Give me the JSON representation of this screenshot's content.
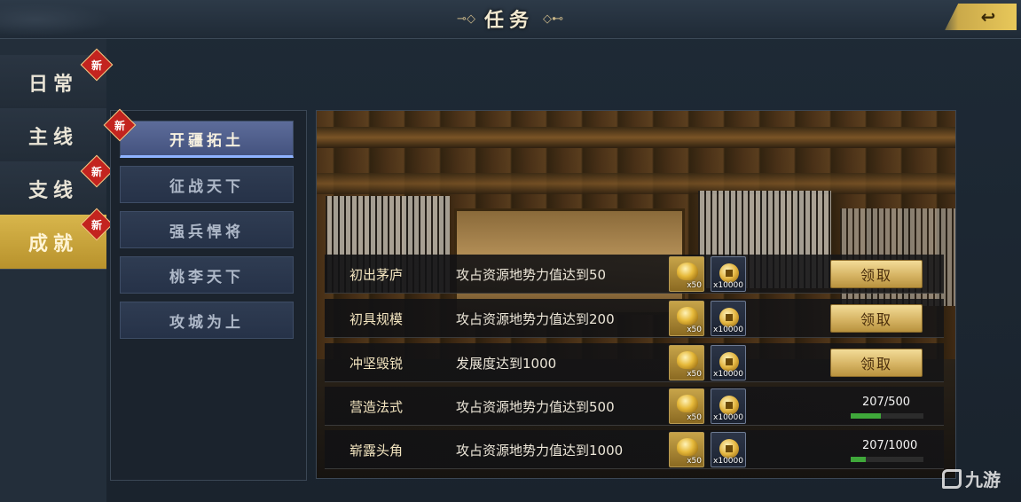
{
  "header": {
    "title": "任务",
    "ornament_left": "⊸◇",
    "ornament_right": "◇⊷",
    "back_icon": "back-arrow-icon"
  },
  "sidebar": {
    "tabs": [
      {
        "label": "日常",
        "badge": "新",
        "active": false
      },
      {
        "label": "主线",
        "badge": "",
        "active": false
      },
      {
        "label": "支线",
        "badge": "新",
        "active": false
      },
      {
        "label": "成就",
        "badge": "新",
        "active": true
      }
    ]
  },
  "subtabs": {
    "badge": "新",
    "items": [
      {
        "label": "开疆拓土",
        "active": true
      },
      {
        "label": "征战天下",
        "active": false
      },
      {
        "label": "强兵悍将",
        "active": false
      },
      {
        "label": "桃李天下",
        "active": false
      },
      {
        "label": "攻城为上",
        "active": false
      }
    ]
  },
  "tasks": [
    {
      "name": "初出茅庐",
      "desc": "攻占资源地势力值达到50",
      "reward1_qty": "x50",
      "reward2_qty": "x10000",
      "status": "claim",
      "claim_label": "领取",
      "progress_text": "",
      "progress_fraction": 1.0
    },
    {
      "name": "初具规模",
      "desc": "攻占资源地势力值达到200",
      "reward1_qty": "x50",
      "reward2_qty": "x10000",
      "status": "claim",
      "claim_label": "领取",
      "progress_text": "",
      "progress_fraction": 1.0
    },
    {
      "name": "冲坚毁锐",
      "desc": "发展度达到1000",
      "reward1_qty": "x50",
      "reward2_qty": "x10000",
      "status": "claim",
      "claim_label": "领取",
      "progress_text": "",
      "progress_fraction": 1.0
    },
    {
      "name": "营造法式",
      "desc": "攻占资源地势力值达到500",
      "reward1_qty": "x50",
      "reward2_qty": "x10000",
      "status": "progress",
      "claim_label": "",
      "progress_text": "207/500",
      "progress_fraction": 0.414
    },
    {
      "name": "崭露头角",
      "desc": "攻占资源地势力值达到1000",
      "reward1_qty": "x50",
      "reward2_qty": "x10000",
      "status": "progress",
      "claim_label": "",
      "progress_text": "207/1000",
      "progress_fraction": 0.207
    }
  ],
  "icons": {
    "reward1": "gold-ingot-icon",
    "reward2": "copper-coin-icon"
  },
  "watermark": {
    "text": "九游"
  }
}
